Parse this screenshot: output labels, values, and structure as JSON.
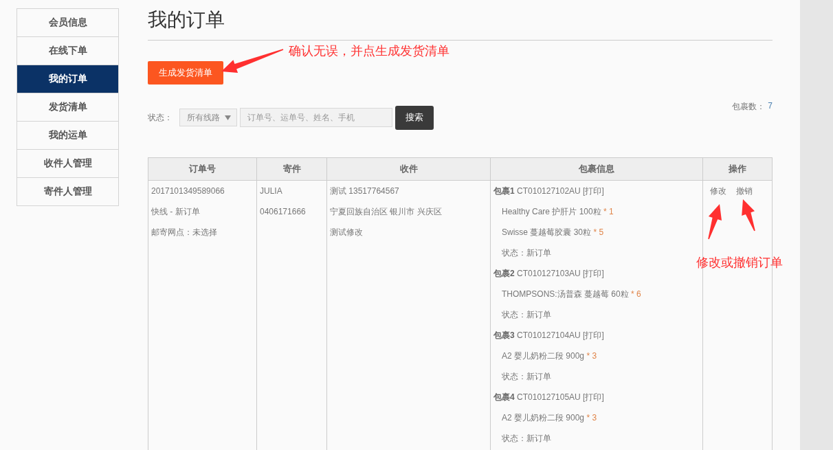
{
  "sidebar": {
    "items": [
      {
        "label": "会员信息",
        "selected": false
      },
      {
        "label": "在线下单",
        "selected": false
      },
      {
        "label": "我的订单",
        "selected": true
      },
      {
        "label": "发货清单",
        "selected": false
      },
      {
        "label": "我的运单",
        "selected": false
      },
      {
        "label": "收件人管理",
        "selected": false
      },
      {
        "label": "寄件人管理",
        "selected": false
      }
    ]
  },
  "page_title": "我的订单",
  "generate_button": "生成发货清单",
  "annotations": [
    {
      "kind": "top",
      "text": "确认无误，并点生成发货清单"
    },
    {
      "kind": "side",
      "text": "修改或撤销订单"
    }
  ],
  "filter": {
    "label": "状态：",
    "select": "所有线路",
    "search_placeholder": "订单号、运单号、姓名、手机",
    "search_button": "搜索",
    "count_label": "包裹数：",
    "count": "7"
  },
  "table": {
    "columns": [
      "订单号",
      "寄件",
      "收件",
      "包裹信息",
      "操作"
    ],
    "rows": [
      {
        "order": [
          "2017101349589066",
          "快线 - 新订单",
          "邮寄网点：未选择"
        ],
        "sender": [
          "JULIA",
          "0406171666"
        ],
        "receiver": [
          "测试 13517764567",
          "宁夏回族自治区 银川市 兴庆区",
          "测试修改"
        ],
        "packages": [
          {
            "label": "包裹1",
            "code": "CT010127102AU",
            "print": "[打印]",
            "items": [
              {
                "name": "Healthy Care 护肝片 100粒",
                "qty": "* 1"
              },
              {
                "name": "Swisse 蔓越莓胶囊 30粒",
                "qty": "* 5"
              }
            ],
            "status": "状态：新订单"
          },
          {
            "label": "包裹2",
            "code": "CT010127103AU",
            "print": "[打印]",
            "items": [
              {
                "name": "THOMPSONS:汤普森 蔓越莓 60粒",
                "qty": "* 6"
              }
            ],
            "status": "状态：新订单"
          },
          {
            "label": "包裹3",
            "code": "CT010127104AU",
            "print": "[打印]",
            "items": [
              {
                "name": "A2 婴儿奶粉二段 900g",
                "qty": "* 3"
              }
            ],
            "status": "状态：新订单"
          },
          {
            "label": "包裹4",
            "code": "CT010127105AU",
            "print": "[打印]",
            "items": [
              {
                "name": "A2 婴儿奶粉二段 900g",
                "qty": "* 3"
              }
            ],
            "status": "状态：新订单"
          }
        ],
        "actions": [
          "修改",
          "撤销"
        ]
      }
    ]
  }
}
